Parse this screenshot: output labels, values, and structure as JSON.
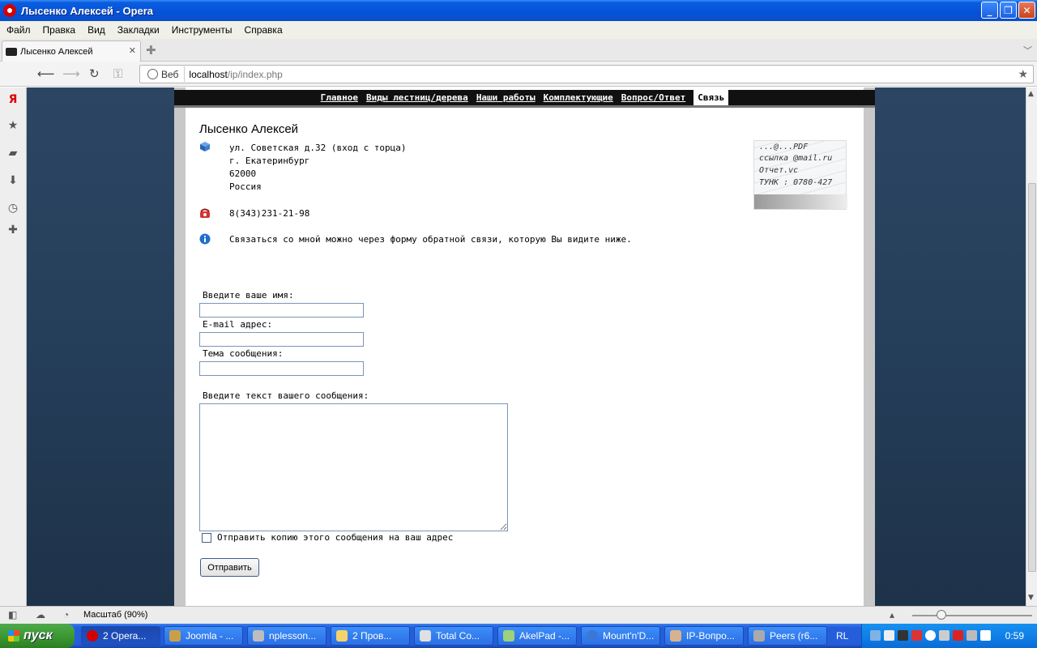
{
  "window": {
    "title": "Лысенко Алексей - Opera"
  },
  "menu": [
    "Файл",
    "Правка",
    "Вид",
    "Закладки",
    "Инструменты",
    "Справка"
  ],
  "tab": {
    "title": "Лысенко Алексей"
  },
  "address": {
    "mode_label": "Веб",
    "host": "localhost",
    "path": "/ip/index.php"
  },
  "nav": {
    "items": [
      "Главное",
      "Виды лестниц/дерева",
      "Наши работы",
      "Комплектующие",
      "Вопрос/Ответ",
      "Связь"
    ],
    "active": "Связь"
  },
  "contact": {
    "name": "Лысенко Алексей",
    "address_lines": [
      "ул. Советская д.32 (вход с торца)",
      "г. Екатеринбург",
      "62000",
      "Россия"
    ],
    "phone": "8(343)231-21-98",
    "info": "Связаться со мной можно через форму обратной связи, которую Вы видите ниже.",
    "image_scribbles": [
      "...@...PDF",
      "ссылка @mail.ru",
      "Отчет.vc",
      "ТУНК : 0780-427"
    ]
  },
  "form": {
    "name_label": "Введите ваше имя:",
    "name_value": "",
    "email_label": "E-mail адрес:",
    "email_value": "",
    "subject_label": "Тема сообщения:",
    "subject_value": "",
    "message_label": "Введите текст вашего сообщения:",
    "message_value": "",
    "copy_label": "Отправить копию этого сообщения на ваш адрес",
    "copy_checked": false,
    "send_label": "Отправить"
  },
  "status": {
    "zoom_label": "Масштаб (90%)",
    "zoom_percent": 90
  },
  "taskbar": {
    "start_label": "пуск",
    "tasks": [
      {
        "label": "2 Opera...",
        "color": "#d40000"
      },
      {
        "label": "Joomla - ...",
        "color": "#c9a04a"
      },
      {
        "label": "nplesson...",
        "color": "#bdbdbd"
      },
      {
        "label": "2 Пров...",
        "color": "#f5d36b"
      },
      {
        "label": "Total Co...",
        "color": "#e0e0e0"
      },
      {
        "label": "AkelPad -...",
        "color": "#9fd07b"
      },
      {
        "label": "Mount'n'D...",
        "color": "#3a78d8"
      },
      {
        "label": "IP-Вопро...",
        "color": "#d8b28e"
      },
      {
        "label": "Peers (r6...",
        "color": "#aaaaaa"
      }
    ],
    "language": "RL",
    "clock": "0:59"
  }
}
